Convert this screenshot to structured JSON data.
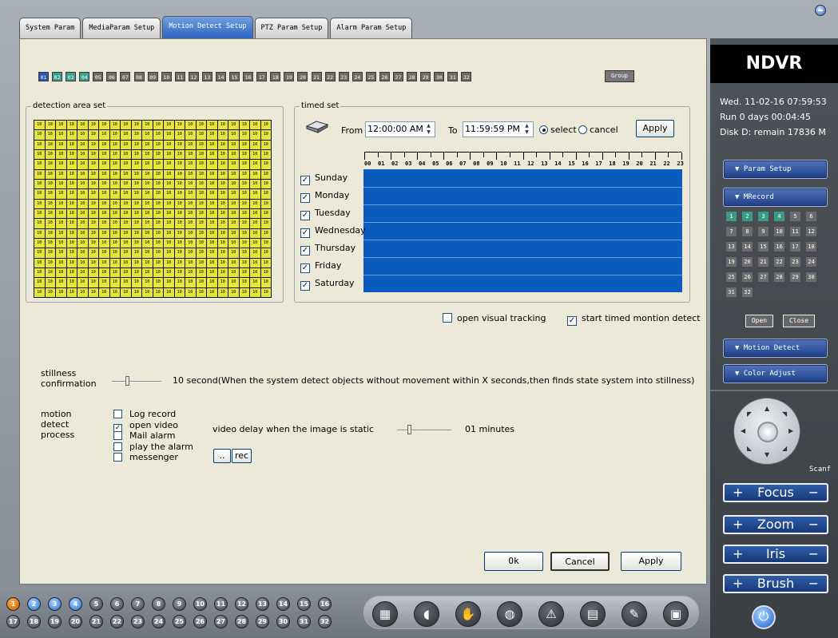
{
  "tabs": [
    "System Param",
    "MediaParam Setup",
    "Motion Detect Setup",
    "PTZ Param Setup",
    "Alarm Param Setup"
  ],
  "active_tab": "Motion Detect Setup",
  "channels": [
    "01",
    "02",
    "03",
    "04",
    "05",
    "06",
    "07",
    "08",
    "09",
    "10",
    "11",
    "12",
    "13",
    "14",
    "15",
    "16",
    "17",
    "18",
    "19",
    "20",
    "21",
    "22",
    "23",
    "24",
    "25",
    "26",
    "27",
    "28",
    "29",
    "30",
    "31",
    "32"
  ],
  "group_label": "Group",
  "detection": {
    "title": "detection area set",
    "cell_label": "10"
  },
  "timed": {
    "title": "timed set",
    "from_label": "From",
    "from_value": "12:00:00 AM",
    "to_label": "To",
    "to_value": "11:59:59 PM",
    "select_label": "select",
    "cancel_label": "cancel",
    "apply_label": "Apply",
    "hours": [
      "00",
      "01",
      "02",
      "03",
      "04",
      "05",
      "06",
      "07",
      "08",
      "09",
      "10",
      "11",
      "12",
      "13",
      "14",
      "15",
      "16",
      "17",
      "18",
      "19",
      "20",
      "21",
      "22",
      "23"
    ],
    "days": [
      "Sunday",
      "Monday",
      "Tuesday",
      "Wednesday",
      "Thursday",
      "Friday",
      "Saturday"
    ]
  },
  "tracking_label": "open visual tracking",
  "timed_detect_label": "start timed montion detect",
  "stillness": {
    "label": "stillness confirmation",
    "text": "10 second(When the system detect objects without movement within X seconds,then finds state system into stillness)"
  },
  "process": {
    "label": "motion detect process",
    "options": [
      "Log record",
      "open video",
      "Mail alarm",
      "play the alarm",
      "messenger"
    ],
    "checked": [
      false,
      true,
      false,
      false,
      false
    ],
    "delay_label": "video delay when the image is static",
    "delay_value": "01 minutes",
    "browse_label": "..",
    "rec_label": "rec"
  },
  "footer": {
    "ok": "Ok",
    "cancel": "Cancel",
    "apply": "Apply"
  },
  "sidebar": {
    "logo": "NDVR",
    "date": "Wed.  11-02-16  07:59:53",
    "run": "Run 0 days  00:04:45",
    "disk": "Disk D: remain 17836 M",
    "param_setup": "▼  Param Setup",
    "mrecord": "▼   MRecord",
    "record_channels": [
      "1",
      "2",
      "3",
      "4",
      "5",
      "6",
      "7",
      "8",
      "9",
      "10",
      "11",
      "12",
      "13",
      "14",
      "15",
      "16",
      "17",
      "18",
      "19",
      "20",
      "21",
      "22",
      "23",
      "24",
      "25",
      "26",
      "27",
      "28",
      "29",
      "30",
      "31",
      "32"
    ],
    "open": "Open",
    "close": "Close",
    "motion_detect": "▼  Motion Detect",
    "color_adjust": "▼  Color Adjust",
    "scan": "Scanf",
    "focus": "Focus",
    "zoom": "Zoom",
    "iris": "Iris",
    "brush": "Brush",
    "plus": "+",
    "minus": "−"
  },
  "bottom_channels": [
    "1",
    "2",
    "3",
    "4",
    "5",
    "6",
    "7",
    "8",
    "9",
    "10",
    "11",
    "12",
    "13",
    "14",
    "15",
    "16",
    "17",
    "18",
    "19",
    "20",
    "21",
    "22",
    "23",
    "24",
    "25",
    "26",
    "27",
    "28",
    "29",
    "30",
    "31",
    "32"
  ],
  "toolbar_icons": [
    "layout-icon",
    "speaker-icon",
    "hand-icon",
    "globe-icon",
    "warning-icon",
    "film-icon",
    "pen-icon",
    "lock-icon"
  ],
  "colors": {
    "schedule": "#0b5bbf",
    "grid_cell": "#e5e53a",
    "panel": "#ece9d8"
  }
}
